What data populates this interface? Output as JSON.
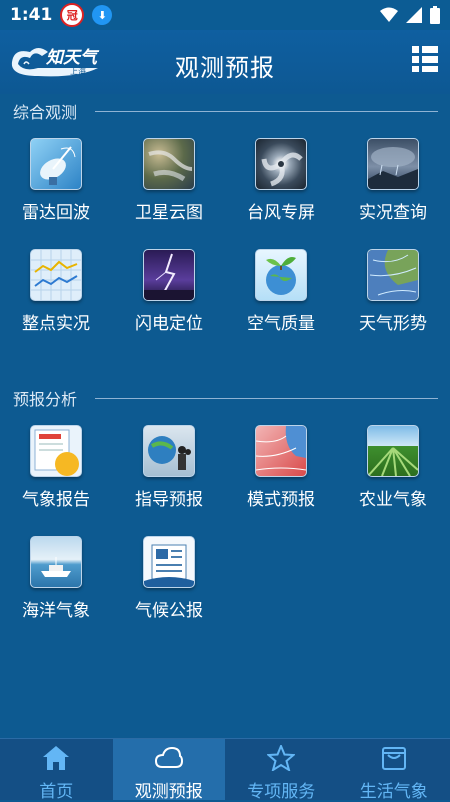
{
  "status": {
    "time": "1:41",
    "app_icon_1": "冠",
    "app_icon_2": "⬇"
  },
  "header": {
    "logo_text": "知天气",
    "logo_sub": "上海",
    "title": "观测预报"
  },
  "sections": [
    {
      "title": "综合观测",
      "items": [
        {
          "label": "雷达回波",
          "icon": "radar-icon"
        },
        {
          "label": "卫星云图",
          "icon": "satellite-icon"
        },
        {
          "label": "台风专屏",
          "icon": "typhoon-icon"
        },
        {
          "label": "实况查询",
          "icon": "live-weather-icon"
        },
        {
          "label": "整点实况",
          "icon": "hourly-chart-icon"
        },
        {
          "label": "闪电定位",
          "icon": "lightning-icon"
        },
        {
          "label": "空气质量",
          "icon": "air-quality-icon"
        },
        {
          "label": "天气形势",
          "icon": "weather-map-icon"
        }
      ]
    },
    {
      "title": "预报分析",
      "items": [
        {
          "label": "气象报告",
          "icon": "report-icon"
        },
        {
          "label": "指导预报",
          "icon": "guidance-icon"
        },
        {
          "label": "模式预报",
          "icon": "model-icon"
        },
        {
          "label": "农业气象",
          "icon": "agriculture-icon"
        },
        {
          "label": "海洋气象",
          "icon": "ocean-icon"
        },
        {
          "label": "气候公报",
          "icon": "climate-bulletin-icon"
        }
      ]
    }
  ],
  "tabs": [
    {
      "label": "首页",
      "icon": "home-icon",
      "active": false
    },
    {
      "label": "观测预报",
      "icon": "cloud-icon",
      "active": true
    },
    {
      "label": "专项服务",
      "icon": "star-icon",
      "active": false
    },
    {
      "label": "生活气象",
      "icon": "bag-icon",
      "active": false
    }
  ]
}
